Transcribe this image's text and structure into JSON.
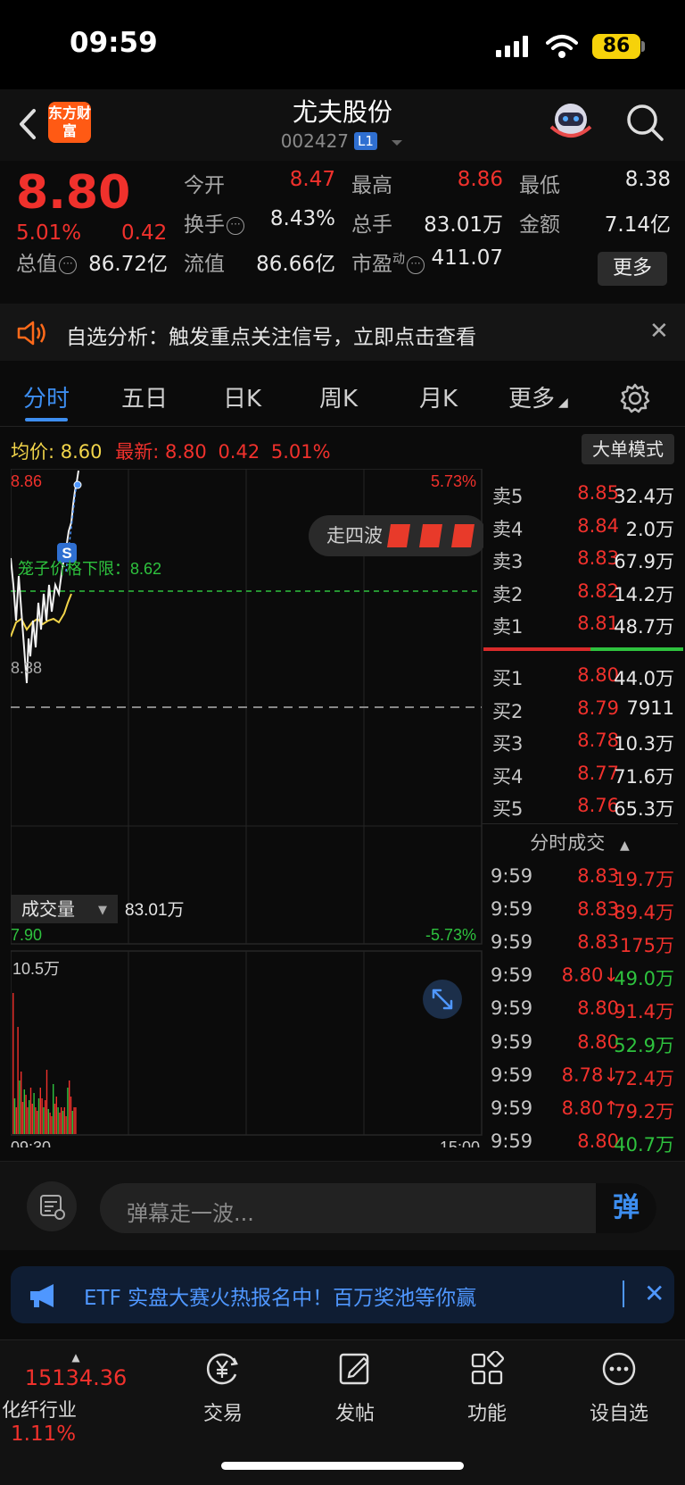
{
  "status_bar": {
    "time": "09:59",
    "battery": "86"
  },
  "header": {
    "logo_text": "东方财富",
    "stock_name": "尤夫股份",
    "stock_code": "002427",
    "level_badge": "L1"
  },
  "quote": {
    "price": "8.80",
    "change_pct": "5.01%",
    "change": "0.42",
    "open_label": "今开",
    "open": "8.47",
    "high_label": "最高",
    "high": "8.86",
    "low_label": "最低",
    "low": "8.38",
    "turnover_label": "换手",
    "turnover": "8.43%",
    "volume_label": "总手",
    "volume": "83.01万",
    "amount_label": "金额",
    "amount": "7.14亿",
    "mktcap_label": "总值",
    "mktcap": "86.72亿",
    "float_label": "流值",
    "float": "86.66亿",
    "pe_label": "市盈",
    "pe_super": "动",
    "pe": "411.07",
    "more": "更多"
  },
  "alert": {
    "text": "自选分析：触发重点关注信号，立即点击查看"
  },
  "tabs": [
    "分时",
    "五日",
    "日K",
    "周K",
    "月K",
    "更多"
  ],
  "chart_head": {
    "avg_label": "均价:",
    "avg": "8.60",
    "latest_label": "最新:",
    "latest": "8.80",
    "change": "0.42",
    "pct": "5.01%",
    "big_order": "大单模式"
  },
  "chart_labels": {
    "top_left": "8.86",
    "top_right": "5.73%",
    "bottom_left": "7.90",
    "bottom_right": "-5.73%",
    "low_line": "8.38",
    "limit_line": "笼子价格下限：8.62",
    "badge_s": "S",
    "wave": "走四波",
    "vol_selector": "成交量",
    "vol_total": "83.01万",
    "vol_max": "10.5万",
    "time_start": "09:30",
    "time_end": "15:00"
  },
  "colors": {
    "up": "#f0312c",
    "down": "#2ec23e",
    "avg_line": "#f2d54a",
    "accent": "#3d8ef0"
  },
  "order_book": {
    "asks": [
      {
        "label": "卖5",
        "price": "8.85",
        "vol": "32.4万"
      },
      {
        "label": "卖4",
        "price": "8.84",
        "vol": "2.0万"
      },
      {
        "label": "卖3",
        "price": "8.83",
        "vol": "67.9万"
      },
      {
        "label": "卖2",
        "price": "8.82",
        "vol": "14.2万"
      },
      {
        "label": "卖1",
        "price": "8.81",
        "vol": "48.7万"
      }
    ],
    "bids": [
      {
        "label": "买1",
        "price": "8.80",
        "vol": "44.0万"
      },
      {
        "label": "买2",
        "price": "8.79",
        "vol": "7911"
      },
      {
        "label": "买3",
        "price": "8.78",
        "vol": "10.3万"
      },
      {
        "label": "买4",
        "price": "8.77",
        "vol": "71.6万"
      },
      {
        "label": "买5",
        "price": "8.76",
        "vol": "65.3万"
      }
    ]
  },
  "ticks": {
    "title": "分时成交",
    "rows": [
      {
        "time": "9:59",
        "price": "8.83",
        "vol": "19.7万",
        "color": "red"
      },
      {
        "time": "9:59",
        "price": "8.83",
        "vol": "89.4万",
        "color": "red"
      },
      {
        "time": "9:59",
        "price": "8.83",
        "vol": "175万",
        "color": "red"
      },
      {
        "time": "9:59",
        "price": "8.80↓",
        "vol": "49.0万",
        "color": "green"
      },
      {
        "time": "9:59",
        "price": "8.80",
        "vol": "91.4万",
        "color": "red"
      },
      {
        "time": "9:59",
        "price": "8.80",
        "vol": "52.9万",
        "color": "green"
      },
      {
        "time": "9:59",
        "price": "8.78↓",
        "vol": "72.4万",
        "color": "red"
      },
      {
        "time": "9:59",
        "price": "8.80↑",
        "vol": "79.2万",
        "color": "red"
      },
      {
        "time": "9:59",
        "price": "8.80",
        "vol": "40.7万",
        "color": "green"
      }
    ]
  },
  "danmaku": {
    "placeholder": "弹幕走一波...",
    "send": "弹"
  },
  "banner": {
    "text": "ETF 实盘大赛火热报名中！百万奖池等你赢"
  },
  "bottom_nav": {
    "index_value": "15134.36",
    "index_name": "化纤行业",
    "index_pct": "1.11%",
    "items": [
      "交易",
      "发帖",
      "功能",
      "设自选"
    ]
  }
}
